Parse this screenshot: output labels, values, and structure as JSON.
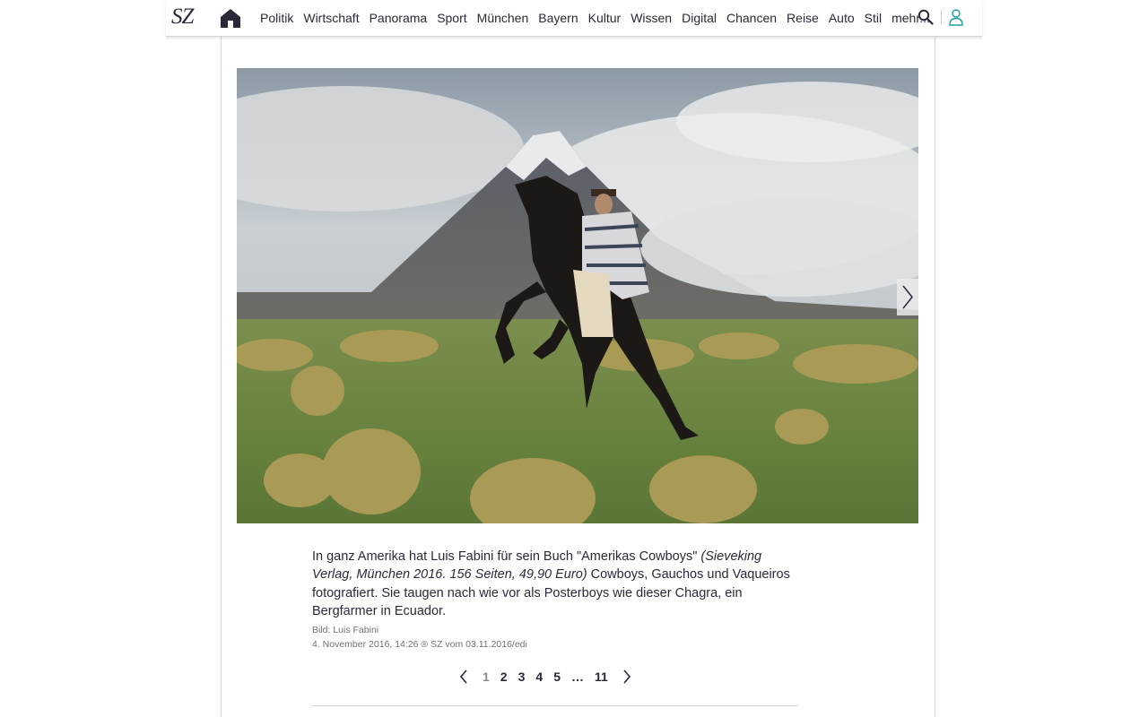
{
  "nav": {
    "logo": "SZ",
    "items": [
      "Politik",
      "Wirtschaft",
      "Panorama",
      "Sport",
      "München",
      "Bayern",
      "Kultur",
      "Wissen",
      "Digital",
      "Chancen",
      "Reise",
      "Auto",
      "Stil",
      "mehr..."
    ],
    "icons": {
      "home": "home-icon",
      "search": "search-icon",
      "user": "user-icon"
    },
    "accent_color": "#1f9ea6"
  },
  "gallery": {
    "photo_icon_next": "chevron-right-icon",
    "caption": {
      "part1": "In ganz Amerika hat Luis Fabini für sein Buch \"Amerikas Cowboys\" ",
      "italic": "(Sieveking Verlag, München 2016. 156 Seiten, 49,90 Euro)",
      "part2": " Cowboys, Gauchos und Vaqueiros fotografiert. Sie taugen nach wie vor als Posterboys wie dieser Chagra, ein Bergfarmer in Ecuador."
    },
    "credit": "Bild: Luis Fabini",
    "dateline": "4. November 2016, 14:26 ® SZ vom 03.11.2016/edi",
    "pagination": {
      "pages": [
        "1",
        "2",
        "3",
        "4",
        "5",
        "…",
        "11"
      ],
      "current": "1"
    }
  }
}
